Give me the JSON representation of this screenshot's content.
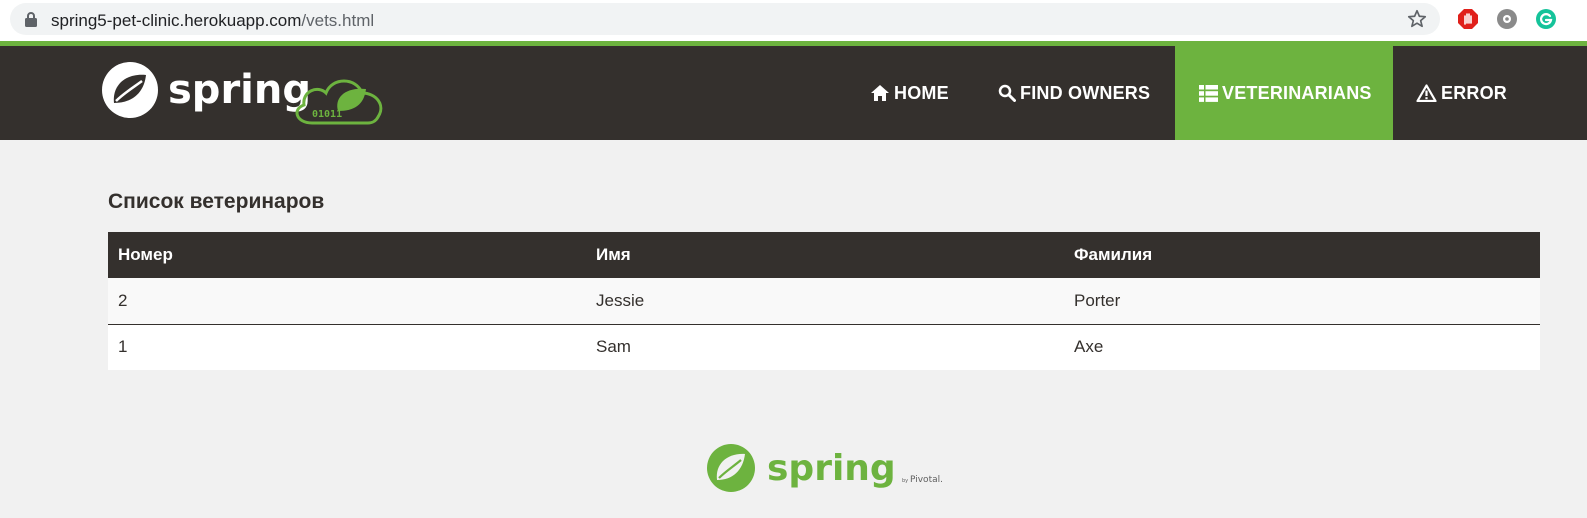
{
  "browser": {
    "url_host": "spring5-pet-clinic.herokuapp.com",
    "url_path": "/vets.html"
  },
  "navbar": {
    "items": [
      {
        "label": "HOME",
        "icon": "home-icon"
      },
      {
        "label": "FIND OWNERS",
        "icon": "search-icon"
      },
      {
        "label": "VETERINARIANS",
        "icon": "list-icon",
        "active": true
      },
      {
        "label": "ERROR",
        "icon": "warning-icon"
      }
    ]
  },
  "main": {
    "title": "Список ветеринаров",
    "table": {
      "headers": [
        "Номер",
        "Имя",
        "Фамилия"
      ],
      "rows": [
        [
          "2",
          "Jessie",
          "Porter"
        ],
        [
          "1",
          "Sam",
          "Axe"
        ]
      ]
    }
  },
  "colors": {
    "accent": "#6db33f",
    "dark": "#34302d",
    "background": "#f1f1f1"
  }
}
